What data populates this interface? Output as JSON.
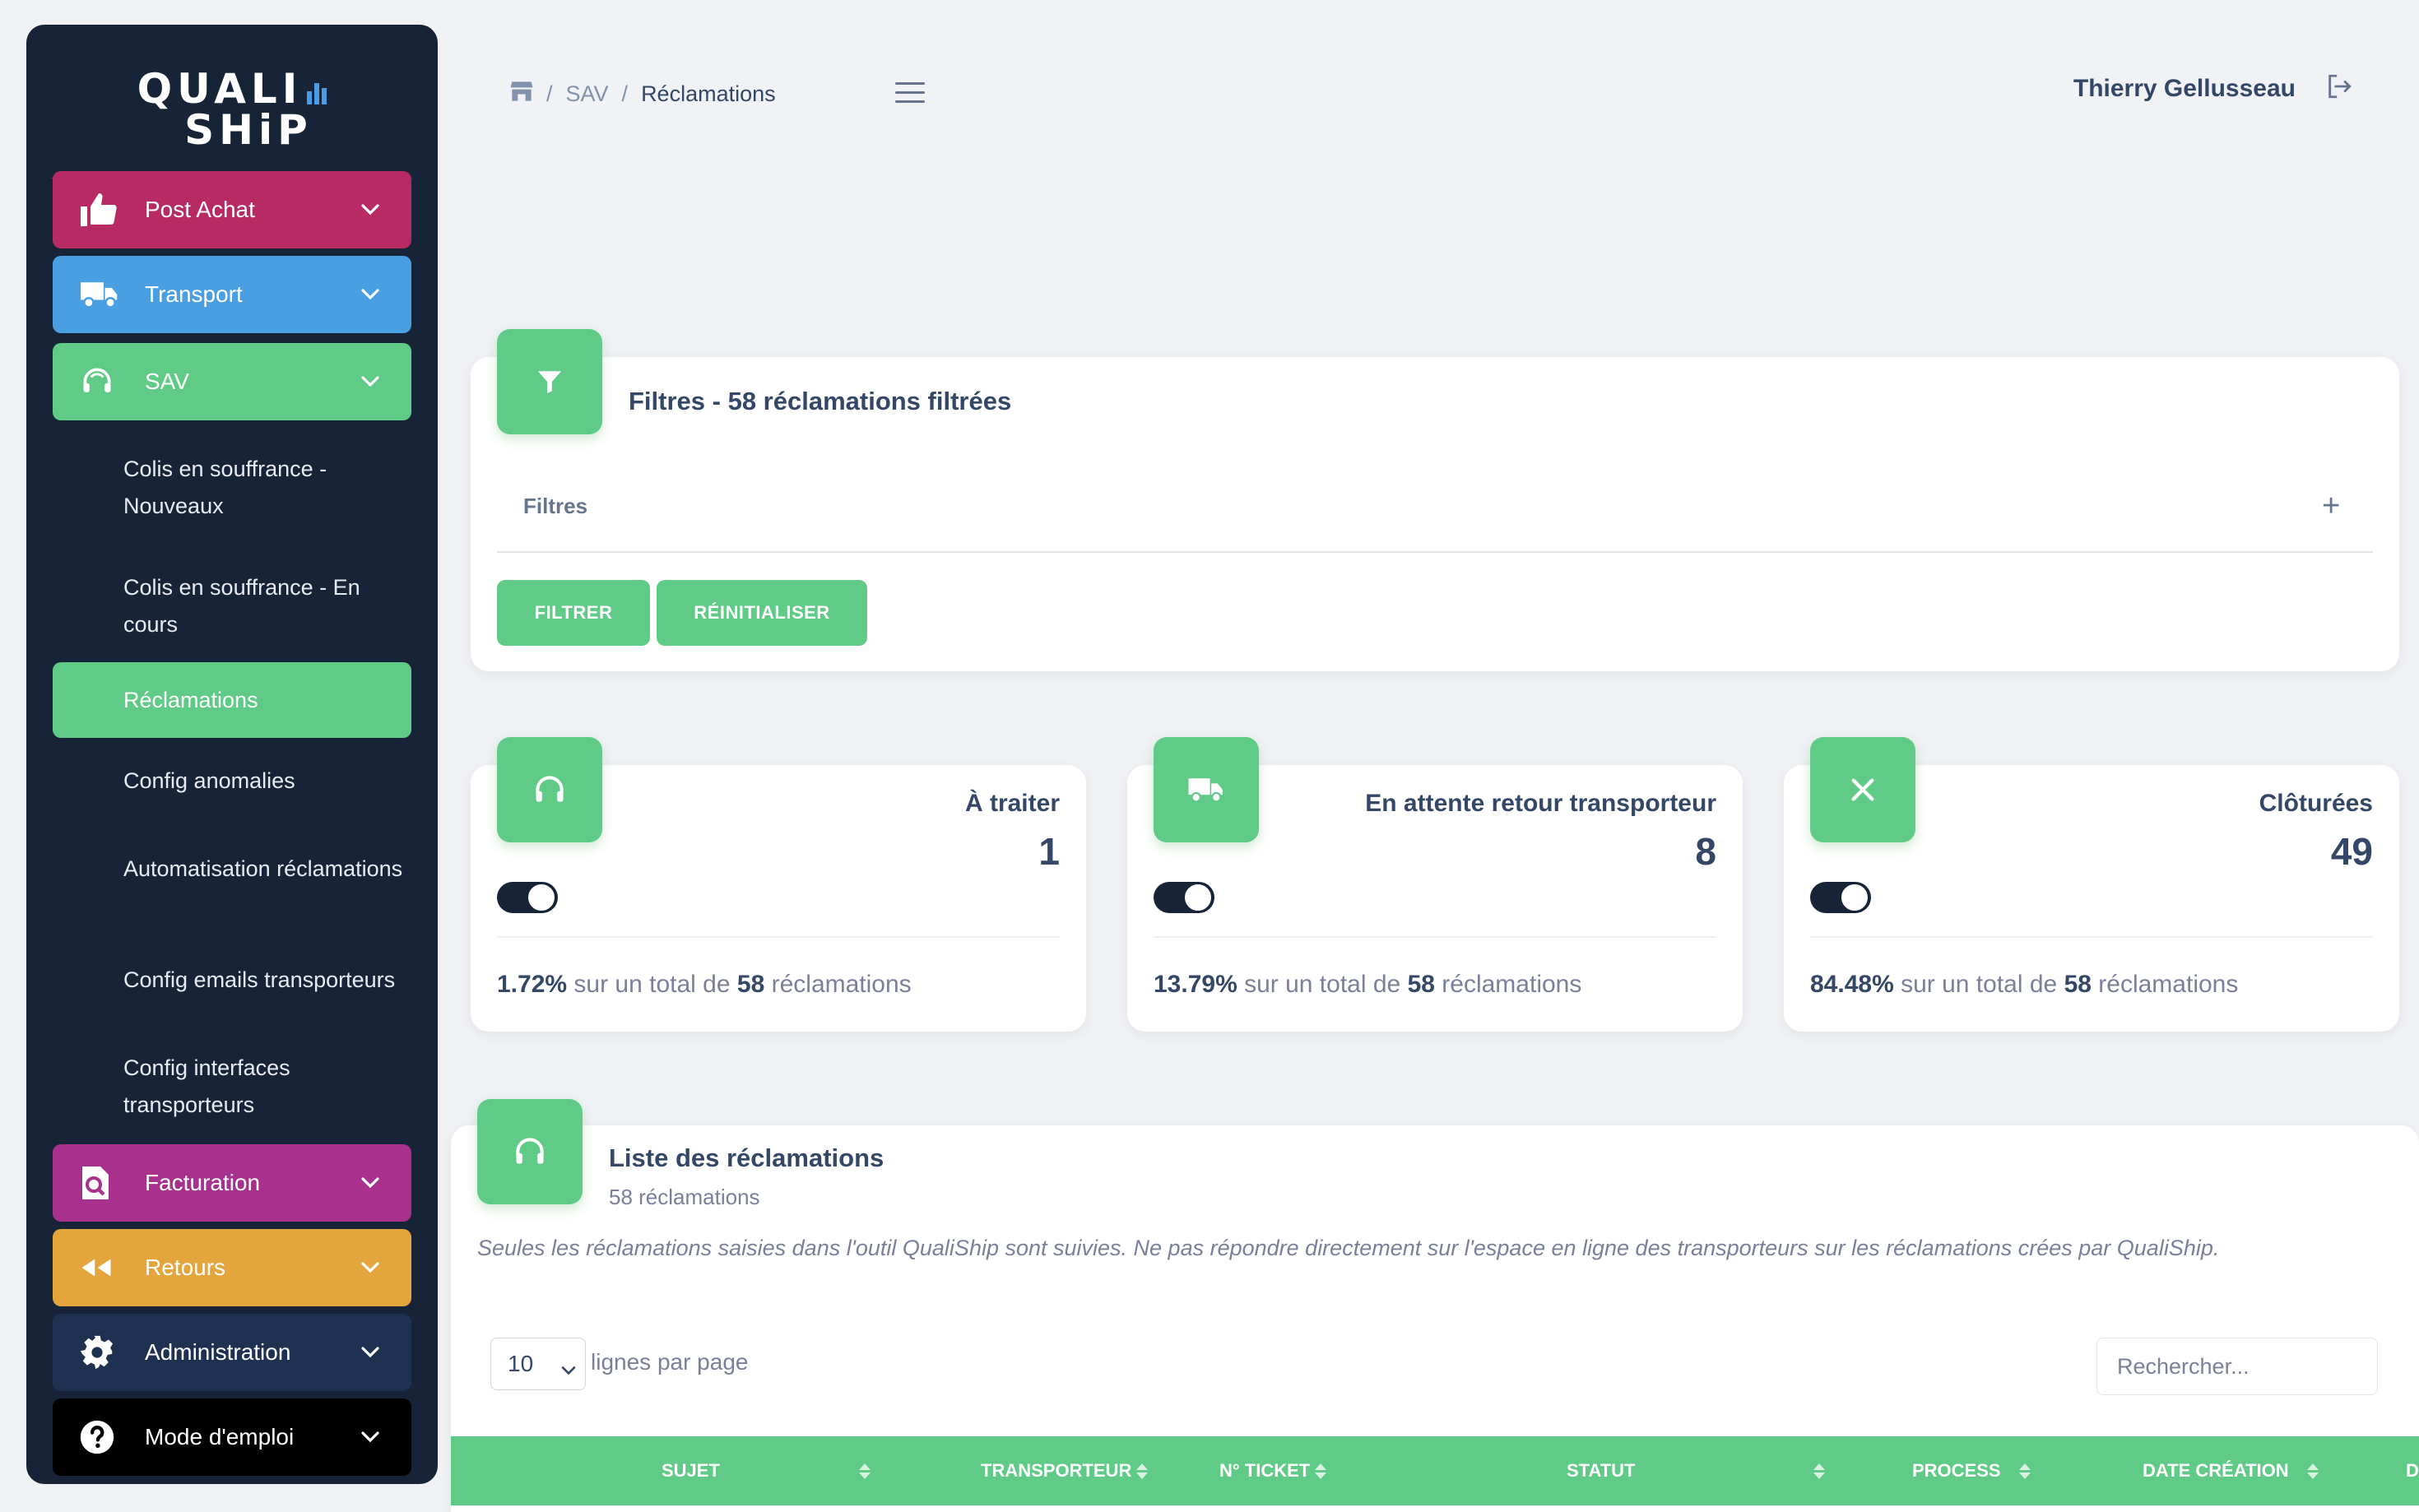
{
  "sidebar": {
    "logo_line1": "QUALI",
    "logo_line2": "SHiP",
    "items": [
      {
        "label": "Post Achat",
        "color": "#b82a63",
        "icon": "thumbs-up-icon"
      },
      {
        "label": "Transport",
        "color": "#4a9ee2",
        "icon": "truck-icon"
      },
      {
        "label": "SAV",
        "color": "#5fcb86",
        "icon": "headset-icon"
      },
      {
        "label": "Facturation",
        "color": "#a8318d",
        "icon": "invoice-search-icon"
      },
      {
        "label": "Retours",
        "color": "#e3a53c",
        "icon": "rewind-icon"
      },
      {
        "label": "Administration",
        "color": "#1e3150",
        "icon": "gear-icon"
      },
      {
        "label": "Mode d'emploi",
        "color": "#000000",
        "icon": "question-icon"
      }
    ],
    "sav_subitems": [
      "Colis en souffrance - Nouveaux",
      "Colis en souffrance - En cours",
      "Réclamations",
      "Config anomalies",
      "Automatisation réclamations",
      "Config emails transporteurs",
      "Config interfaces transporteurs"
    ]
  },
  "header": {
    "breadcrumb": [
      "SAV",
      "Réclamations"
    ],
    "user_name": "Thierry Gellusseau"
  },
  "filters": {
    "title": "Filtres - 58 réclamations filtrées",
    "row_label": "Filtres",
    "expand_symbol": "+",
    "filter_button": "FILTRER",
    "reset_button": "RÉINITIALISER"
  },
  "stats": [
    {
      "title": "À traiter",
      "value": "1",
      "percent": "1.72%",
      "total": "58",
      "icon": "headset-icon"
    },
    {
      "title": "En attente retour transporteur",
      "value": "8",
      "percent": "13.79%",
      "total": "58",
      "icon": "truck-icon"
    },
    {
      "title": "Clôturées",
      "value": "49",
      "percent": "84.48%",
      "total": "58",
      "icon": "close-icon"
    }
  ],
  "stat_text": {
    "middle": "sur un total de",
    "suffix": "réclamations"
  },
  "list": {
    "title": "Liste des réclamations",
    "subtitle": "58 réclamations",
    "notice": "Seules les réclamations saisies dans l'outil QualiShip sont suivies. Ne pas répondre directement sur l'espace en ligne des transporteurs sur les réclamations crées par QualiShip.",
    "per_page_value": "10",
    "per_page_label": "lignes par page",
    "search_placeholder": "Rechercher...",
    "columns": [
      "SUJET",
      "TRANSPORTEUR",
      "N° TICKET",
      "STATUT",
      "PROCESS",
      "DATE CRÉATION",
      "D"
    ]
  },
  "colors": {
    "accent_green": "#5fcb86",
    "sidebar_bg": "#172337",
    "page_bg": "#f0f2f5"
  }
}
